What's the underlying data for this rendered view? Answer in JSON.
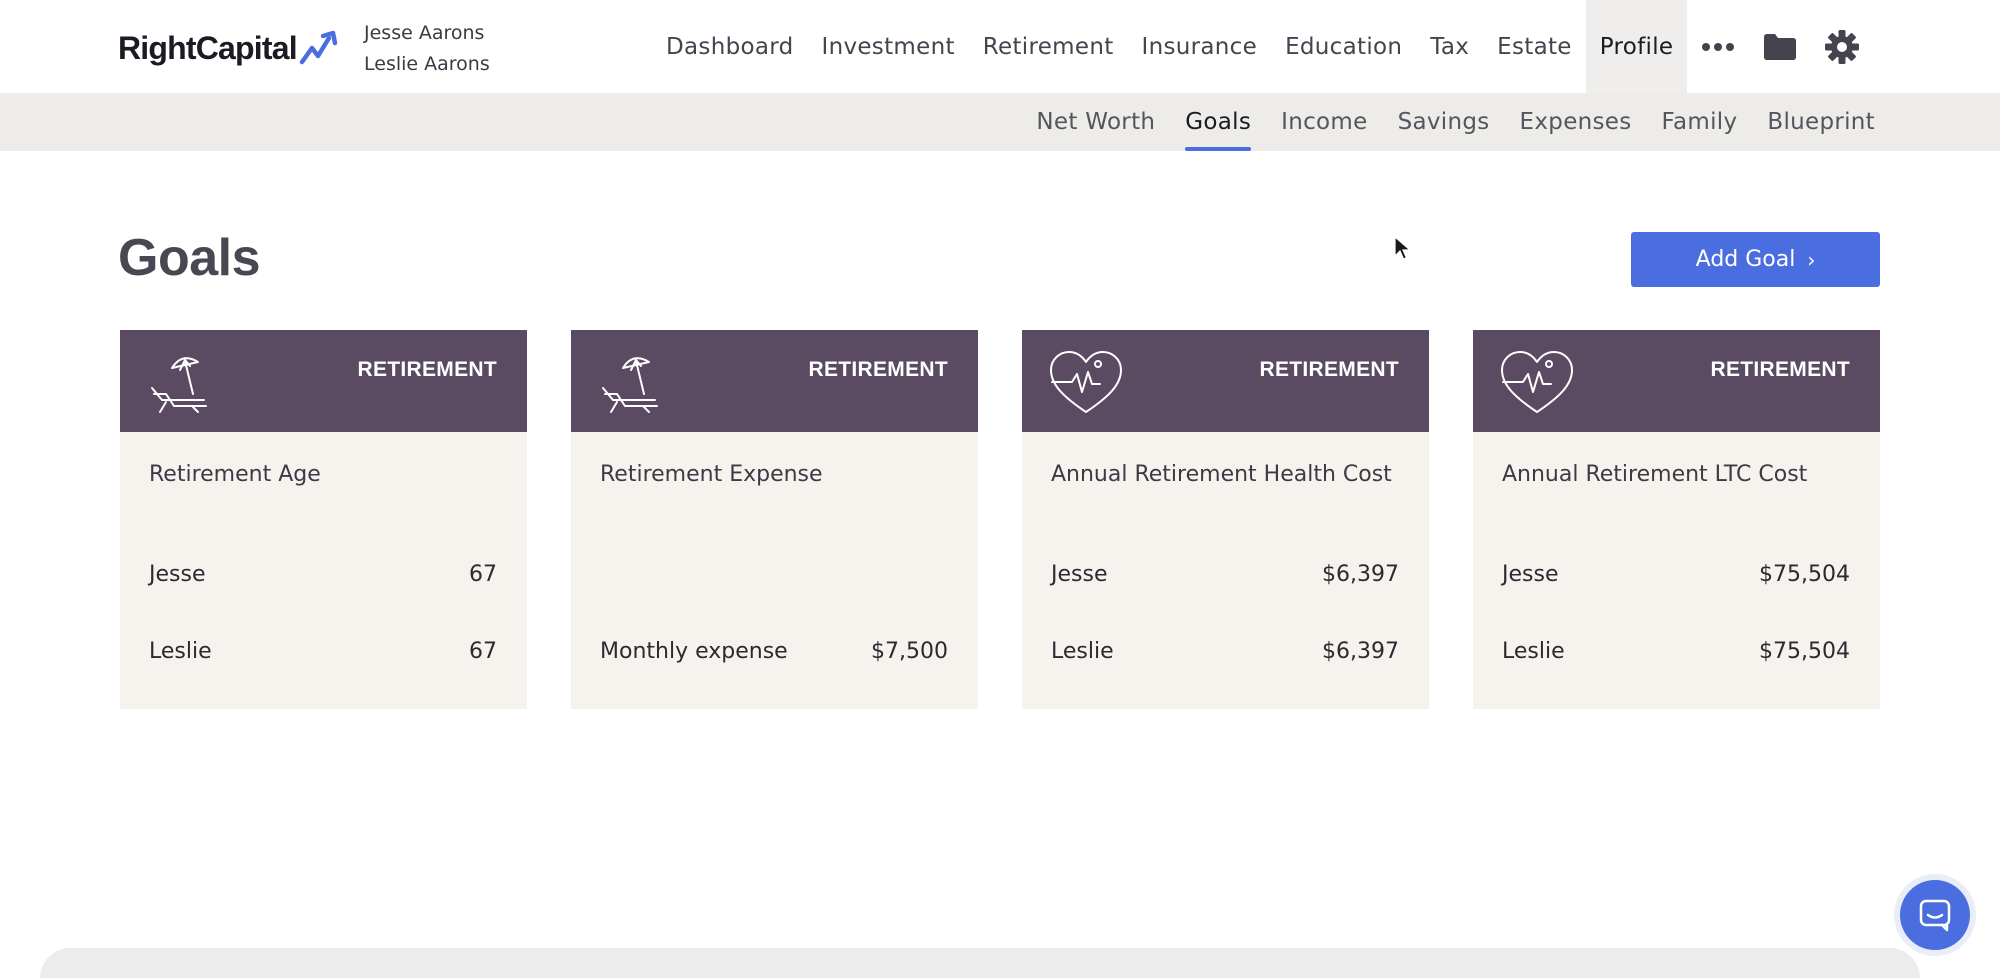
{
  "header": {
    "logo_text": "RightCapital",
    "clients": [
      "Jesse Aarons",
      "Leslie Aarons"
    ],
    "nav": [
      {
        "label": "Dashboard",
        "active": false
      },
      {
        "label": "Investment",
        "active": false
      },
      {
        "label": "Retirement",
        "active": false
      },
      {
        "label": "Insurance",
        "active": false
      },
      {
        "label": "Education",
        "active": false
      },
      {
        "label": "Tax",
        "active": false
      },
      {
        "label": "Estate",
        "active": false
      },
      {
        "label": "Profile",
        "active": true
      }
    ],
    "icons": [
      "more-icon",
      "folder-icon",
      "gear-icon"
    ]
  },
  "subnav": [
    {
      "label": "Net Worth",
      "active": false
    },
    {
      "label": "Goals",
      "active": true
    },
    {
      "label": "Income",
      "active": false
    },
    {
      "label": "Savings",
      "active": false
    },
    {
      "label": "Expenses",
      "active": false
    },
    {
      "label": "Family",
      "active": false
    },
    {
      "label": "Blueprint",
      "active": false
    }
  ],
  "page": {
    "title": "Goals",
    "add_goal_label": "Add Goal"
  },
  "cards": [
    {
      "category": "RETIREMENT",
      "icon": "beach-chair-icon",
      "title": "Retirement Age",
      "rows": [
        {
          "label": "Jesse",
          "value": "67"
        },
        {
          "label": "Leslie",
          "value": "67"
        }
      ]
    },
    {
      "category": "RETIREMENT",
      "icon": "beach-chair-icon",
      "title": "Retirement Expense",
      "rows": [
        {
          "label": "",
          "value": ""
        },
        {
          "label": "Monthly expense",
          "value": "$7,500"
        }
      ]
    },
    {
      "category": "RETIREMENT",
      "icon": "heart-pulse-icon",
      "title": "Annual Retirement Health Cost",
      "rows": [
        {
          "label": "Jesse",
          "value": "$6,397"
        },
        {
          "label": "Leslie",
          "value": "$6,397"
        }
      ]
    },
    {
      "category": "RETIREMENT",
      "icon": "heart-pulse-icon",
      "title": "Annual Retirement LTC Cost",
      "rows": [
        {
          "label": "Jesse",
          "value": "$75,504"
        },
        {
          "label": "Leslie",
          "value": "$75,504"
        }
      ]
    }
  ],
  "colors": {
    "accent": "#4a6ee0",
    "card_header": "#5a4b63",
    "card_body": "#f6f3ef",
    "subnav_bg": "#edece8"
  }
}
